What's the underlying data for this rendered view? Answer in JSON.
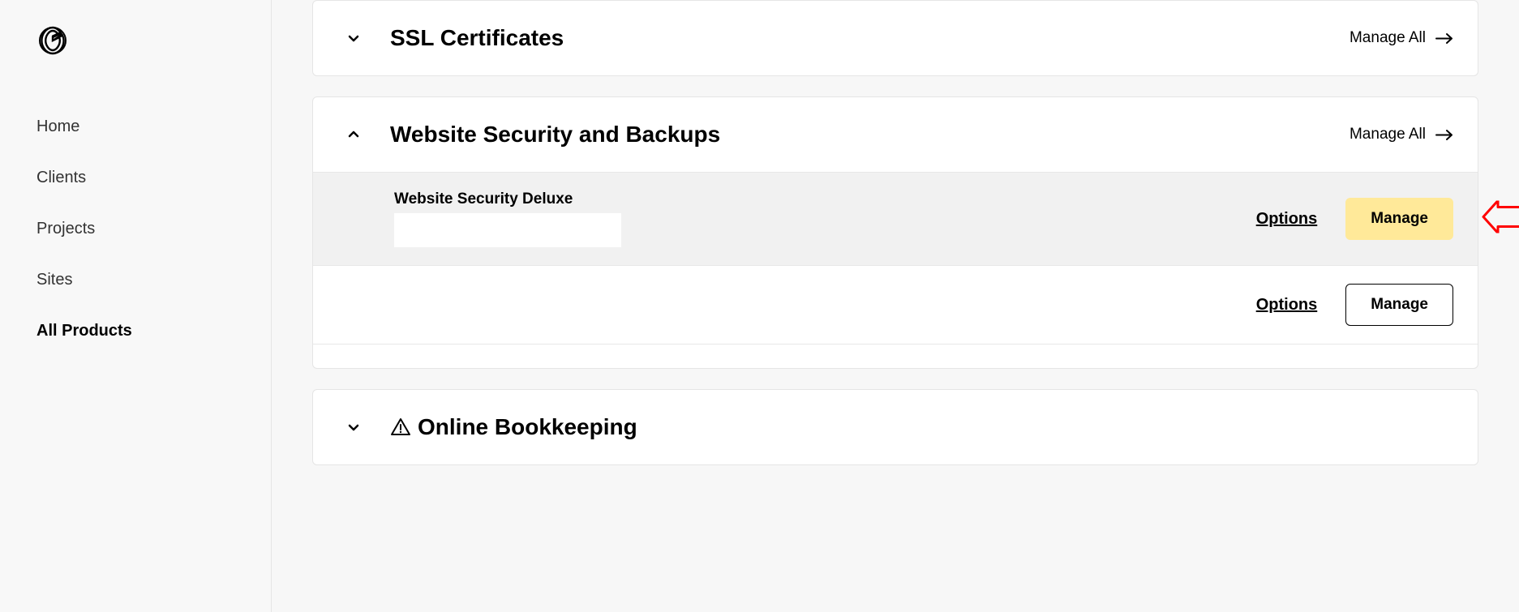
{
  "sidebar": {
    "nav": [
      {
        "label": "Home",
        "active": false
      },
      {
        "label": "Clients",
        "active": false
      },
      {
        "label": "Projects",
        "active": false
      },
      {
        "label": "Sites",
        "active": false
      },
      {
        "label": "All Products",
        "active": true
      }
    ]
  },
  "sections": {
    "ssl": {
      "title": "SSL Certificates",
      "manage_all": "Manage All"
    },
    "security": {
      "title": "Website Security and Backups",
      "manage_all": "Manage All",
      "products": [
        {
          "name": "Website Security Deluxe",
          "options_label": "Options",
          "manage_label": "Manage",
          "highlighted": true
        },
        {
          "name": "",
          "options_label": "Options",
          "manage_label": "Manage",
          "highlighted": false
        }
      ]
    },
    "bookkeeping": {
      "title": "Online Bookkeeping"
    }
  }
}
